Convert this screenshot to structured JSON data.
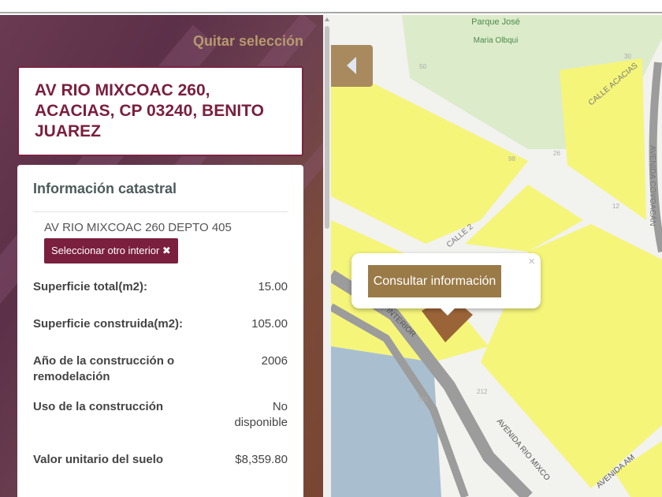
{
  "panel": {
    "remove_selection": "Quitar selección",
    "address_title": "AV RIO MIXCOAC 260, ACACIAS, CP 03240, BENITO JUAREZ",
    "info": {
      "heading": "Información catastral",
      "interior": "AV RIO MIXCOAC 260 DEPTO 405",
      "select_other_button": "Seleccionar otro interior",
      "select_other_icon": "✖",
      "rows": [
        {
          "label": "Superficie total(m2):",
          "value": "15.00"
        },
        {
          "label": "Superficie construida(m2):",
          "value": "105.00"
        },
        {
          "label": "Año de la construcción o remodelación",
          "value": "2006"
        },
        {
          "label": "Uso de la construcción",
          "value": "No disponible"
        },
        {
          "label": "Valor unitario del suelo",
          "value": "$8,359.80"
        }
      ]
    }
  },
  "map": {
    "popup": {
      "button": "Consultar información",
      "close": "×"
    },
    "labels": {
      "park_line1": "Parque José",
      "park_line2": "Maria Olbqui",
      "calle_acacias": "CALLE ACACIAS",
      "calle_2": "CALLE 2",
      "calle_2b": "CA",
      "av_coyoacan": "AVENIDA COYOACÁN",
      "interior": "INTERIOR",
      "av_rio_mixcoac": "AVENIDA RIO MIXCO",
      "av_am": "AVENIDA AM",
      "n50": "50",
      "n30": "30",
      "n26": "26",
      "n12": "12",
      "n98": "98",
      "n212": "212",
      "n201": "201"
    },
    "colors": {
      "parcel": "#f5f57a",
      "park": "#dcebc9",
      "selected": "#9a6438",
      "water": "#a9bfd0"
    }
  }
}
